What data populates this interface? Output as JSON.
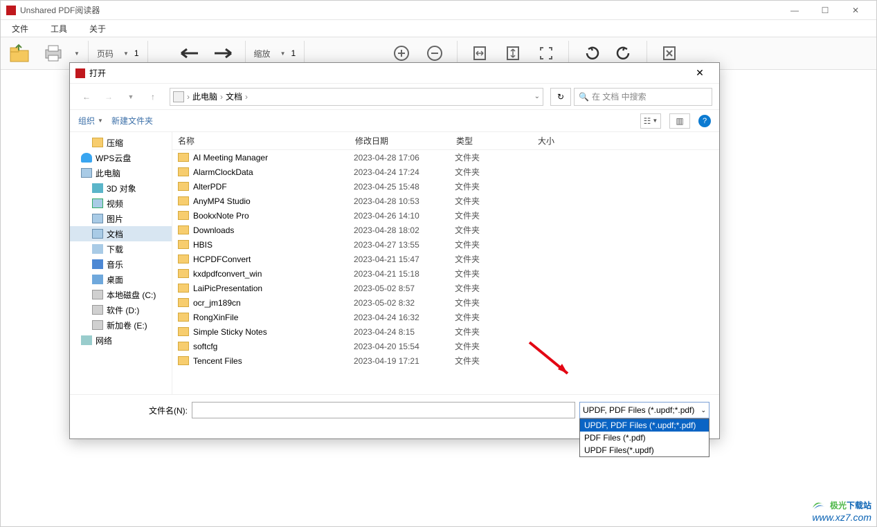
{
  "window": {
    "title": "Unshared PDF阅读器"
  },
  "menu": {
    "file": "文件",
    "tools": "工具",
    "about": "关于"
  },
  "toolbar": {
    "page_label": "页码",
    "page_value": "1",
    "zoom_label": "缩放",
    "zoom_value": "1"
  },
  "dialog": {
    "title": "打开",
    "breadcrumb": {
      "pc": "此电脑",
      "docs": "文档"
    },
    "search_placeholder": "在 文档 中搜索",
    "organize": "组织",
    "new_folder": "新建文件夹",
    "columns": {
      "name": "名称",
      "date": "修改日期",
      "type": "类型",
      "size": "大小"
    },
    "filename_label": "文件名(N):",
    "filetype_selected": "UPDF, PDF Files (*.updf;*.pdf)",
    "filetype_options": [
      "UPDF, PDF Files (*.updf;*.pdf)",
      "PDF Files (*.pdf)",
      "UPDF Files(*.updf)"
    ]
  },
  "sidebar": [
    {
      "label": "压缩",
      "icon": "ico-folder",
      "indent": true
    },
    {
      "label": "WPS云盘",
      "icon": "ico-cloud"
    },
    {
      "label": "此电脑",
      "icon": "ico-pc"
    },
    {
      "label": "3D 对象",
      "icon": "ico-3d",
      "indent": true
    },
    {
      "label": "视频",
      "icon": "ico-video",
      "indent": true
    },
    {
      "label": "图片",
      "icon": "ico-pic",
      "indent": true
    },
    {
      "label": "文档",
      "icon": "ico-doc",
      "indent": true,
      "active": true
    },
    {
      "label": "下载",
      "icon": "ico-dl",
      "indent": true
    },
    {
      "label": "音乐",
      "icon": "ico-music",
      "indent": true
    },
    {
      "label": "桌面",
      "icon": "ico-desk",
      "indent": true
    },
    {
      "label": "本地磁盘 (C:)",
      "icon": "ico-disk",
      "indent": true
    },
    {
      "label": "软件 (D:)",
      "icon": "ico-disk",
      "indent": true
    },
    {
      "label": "新加卷 (E:)",
      "icon": "ico-disk",
      "indent": true
    },
    {
      "label": "网络",
      "icon": "ico-net"
    }
  ],
  "files": [
    {
      "name": "AI Meeting Manager",
      "date": "2023-04-28 17:06",
      "type": "文件夹"
    },
    {
      "name": "AlarmClockData",
      "date": "2023-04-24 17:24",
      "type": "文件夹"
    },
    {
      "name": "AlterPDF",
      "date": "2023-04-25 15:48",
      "type": "文件夹"
    },
    {
      "name": "AnyMP4 Studio",
      "date": "2023-04-28 10:53",
      "type": "文件夹"
    },
    {
      "name": "BookxNote Pro",
      "date": "2023-04-26 14:10",
      "type": "文件夹"
    },
    {
      "name": "Downloads",
      "date": "2023-04-28 18:02",
      "type": "文件夹"
    },
    {
      "name": "HBIS",
      "date": "2023-04-27 13:55",
      "type": "文件夹"
    },
    {
      "name": "HCPDFConvert",
      "date": "2023-04-21 15:47",
      "type": "文件夹"
    },
    {
      "name": "kxdpdfconvert_win",
      "date": "2023-04-21 15:18",
      "type": "文件夹"
    },
    {
      "name": "LaiPicPresentation",
      "date": "2023-05-02 8:57",
      "type": "文件夹"
    },
    {
      "name": "ocr_jm189cn",
      "date": "2023-05-02 8:32",
      "type": "文件夹"
    },
    {
      "name": "RongXinFile",
      "date": "2023-04-24 16:32",
      "type": "文件夹"
    },
    {
      "name": "Simple Sticky Notes",
      "date": "2023-04-24 8:15",
      "type": "文件夹"
    },
    {
      "name": "softcfg",
      "date": "2023-04-20 15:54",
      "type": "文件夹"
    },
    {
      "name": "Tencent Files",
      "date": "2023-04-19 17:21",
      "type": "文件夹"
    }
  ],
  "watermark": {
    "brand1": "极光",
    "brand2": "下载站",
    "url": "www.xz7.com"
  }
}
